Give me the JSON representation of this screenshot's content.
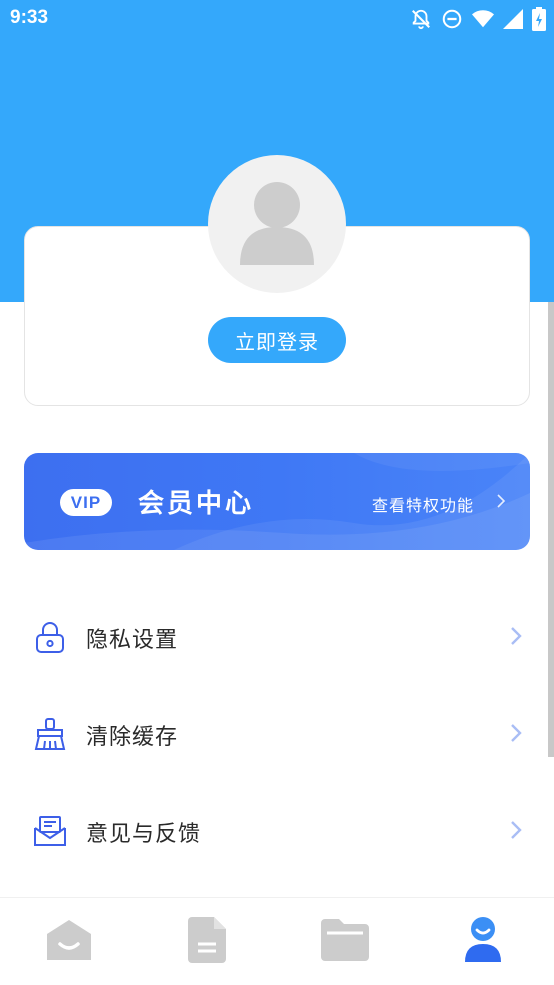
{
  "status_bar": {
    "time": "9:33",
    "icons": [
      "notifications-off-icon",
      "do-not-disturb-icon",
      "wifi-icon",
      "signal-icon",
      "battery-charging-icon"
    ]
  },
  "colors": {
    "header": "#34a8fb",
    "vip_gradient_start": "#3d6ff0",
    "vip_gradient_end": "#4a84f8",
    "menu_icon": "#3d5fe8",
    "chevron": "#a9bdf5",
    "nav_inactive": "#cccccc",
    "nav_active": "#2f6bf0"
  },
  "profile": {
    "avatar_icon": "user-avatar-icon",
    "login_label": "立即登录"
  },
  "vip": {
    "badge": "VIP",
    "title": "会员中心",
    "link_label": "查看特权功能"
  },
  "menu": [
    {
      "label": "隐私设置",
      "icon": "lock-icon"
    },
    {
      "label": "清除缓存",
      "icon": "broom-icon"
    },
    {
      "label": "意见与反馈",
      "icon": "mail-icon"
    }
  ],
  "bottom_nav": [
    {
      "icon": "home-icon",
      "active": false
    },
    {
      "icon": "document-icon",
      "active": false
    },
    {
      "icon": "folder-icon",
      "active": false
    },
    {
      "icon": "profile-icon",
      "active": true
    }
  ]
}
